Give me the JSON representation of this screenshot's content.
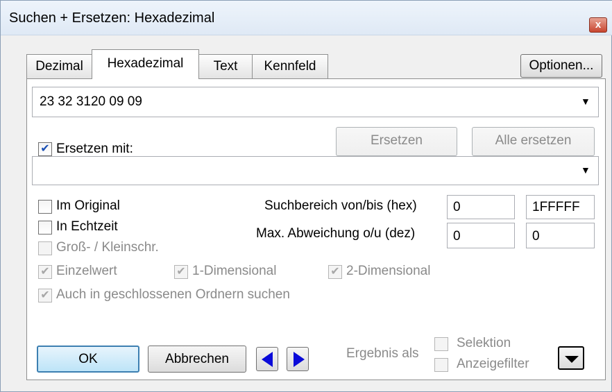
{
  "window": {
    "title": "Suchen + Ersetzen: Hexadezimal",
    "close_glyph": "x"
  },
  "tabs": [
    {
      "label": "Dezimal",
      "active": false
    },
    {
      "label": "Hexadezimal",
      "active": true
    },
    {
      "label": "Text",
      "active": false
    },
    {
      "label": "Kennfeld",
      "active": false
    }
  ],
  "options_button": "Optionen...",
  "search": {
    "value": "23 32 3120 09 09",
    "arrow": "▼"
  },
  "replace": {
    "checkbox_label": "Ersetzen mit:",
    "checked": true,
    "check_glyph": "✔",
    "value": "",
    "arrow": "▼",
    "replace_button": "Ersetzen",
    "replace_all_button": "Alle ersetzen"
  },
  "options": {
    "im_original": "Im Original",
    "in_echtzeit": "In Echtzeit",
    "gross_klein": "Groß- / Kleinschr.",
    "einzelwert": "Einzelwert",
    "eindimensional": "1-Dimensional",
    "zweidimensional": "2-Dimensional",
    "geschlossene_ordner": "Auch in geschlossenen Ordnern suchen",
    "check_glyph": "✔"
  },
  "range": {
    "suchbereich_label": "Suchbereich von/bis (hex)",
    "suchbereich_von": "0",
    "suchbereich_bis": "1FFFFF",
    "abweichung_label": "Max. Abweichung o/u (dez)",
    "abweichung_oben": "0",
    "abweichung_unten": "0"
  },
  "footer": {
    "ok": "OK",
    "cancel": "Abbrechen",
    "ergebnis_als": "Ergebnis als",
    "selektion": "Selektion",
    "anzeigefilter": "Anzeigefilter"
  },
  "colors": {
    "accent": "#3c7fb1",
    "nav_arrow": "#0a0ad9",
    "disabled_text": "#8a8a8a"
  }
}
